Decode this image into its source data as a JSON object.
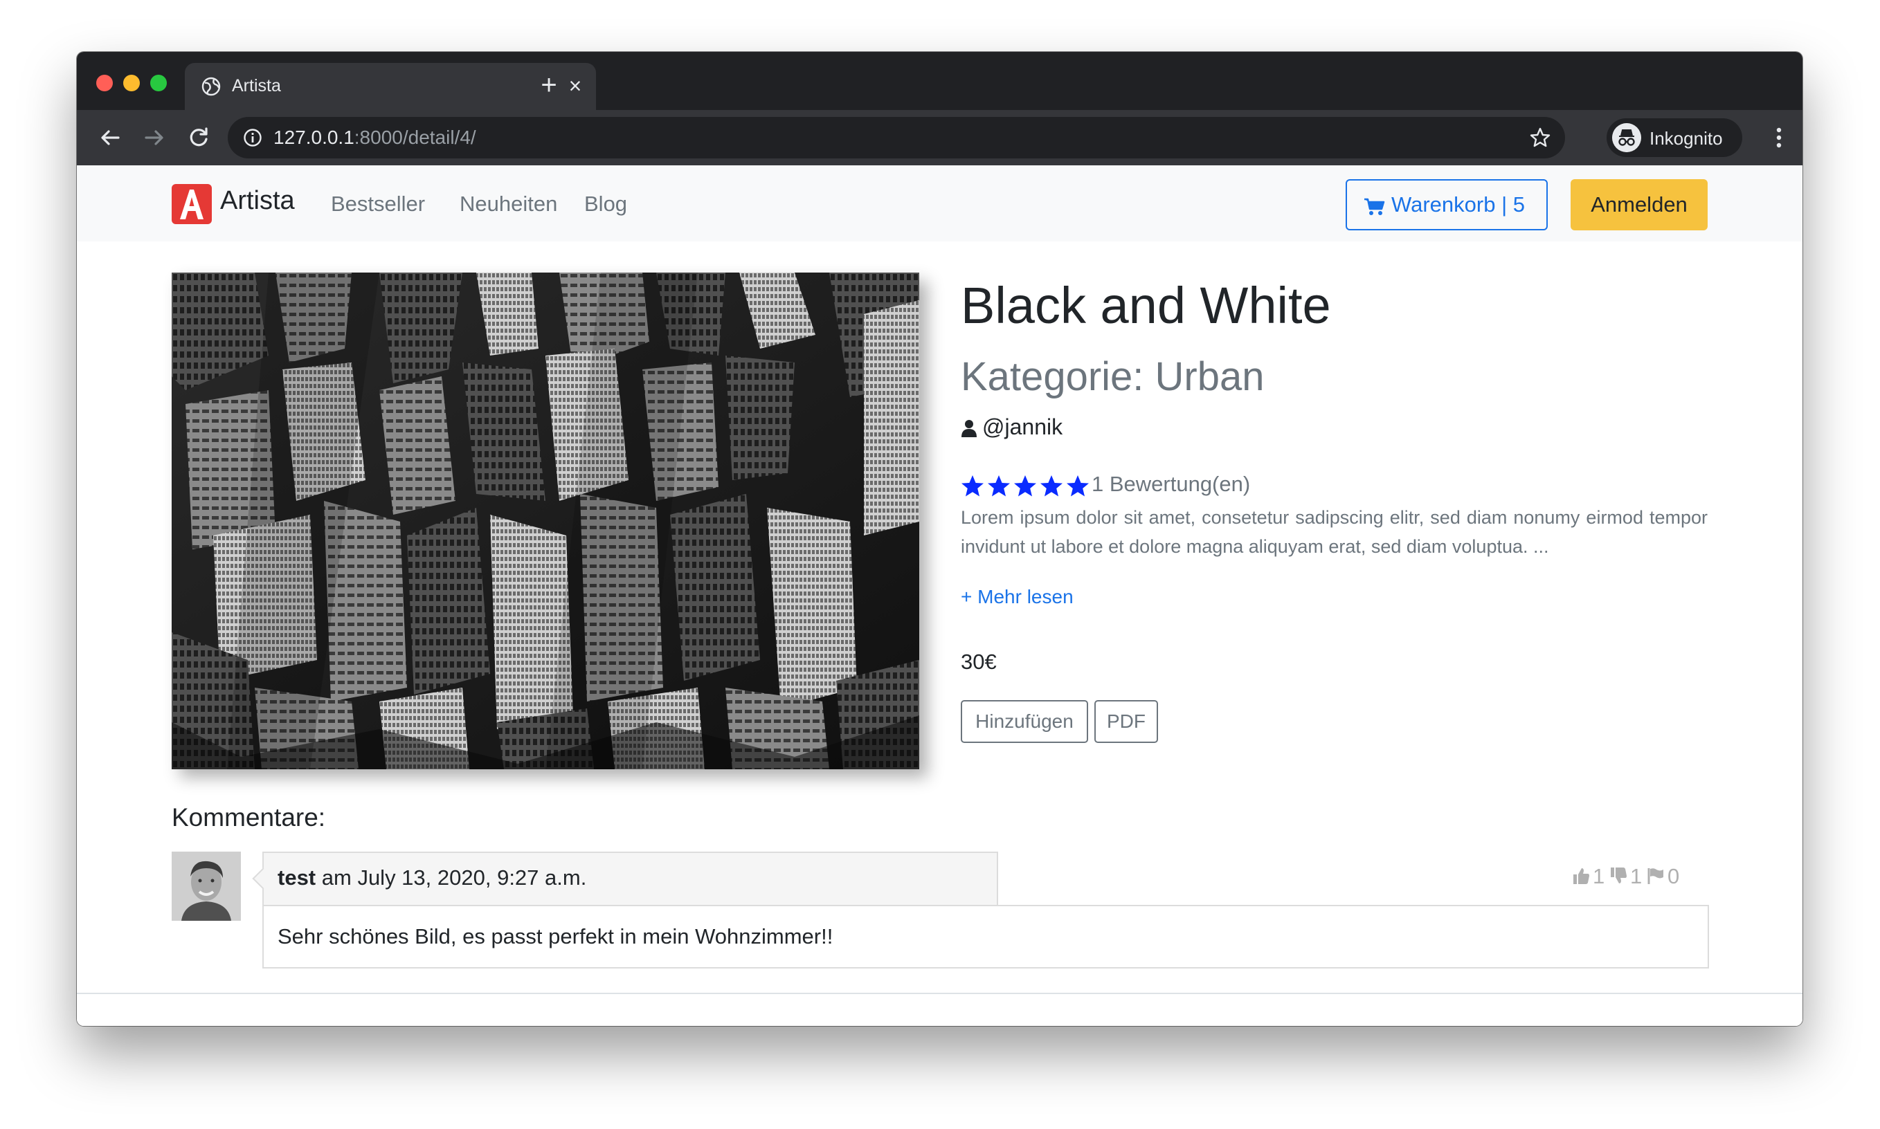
{
  "browser": {
    "tab_title": "Artista",
    "url_host": "127.0.0.1",
    "url_path": ":8000/detail/4/",
    "profile_label": "Inkognito"
  },
  "navbar": {
    "brand": "Artista",
    "links": [
      "Bestseller",
      "Neuheiten",
      "Blog"
    ],
    "cart_label": "Warenkorb | 5",
    "login_label": "Anmelden"
  },
  "product": {
    "title": "Black and White",
    "category": "Kategorie: Urban",
    "author": "@jannik",
    "rating_stars": 5,
    "rating_text": "1 Bewertung(en)",
    "description": "Lorem ipsum dolor sit amet, consetetur sadipscing elitr, sed diam nonumy eirmod tempor invidunt ut labore et dolore magna aliquyam erat, sed diam voluptua. ...",
    "more_link": "+ Mehr lesen",
    "price": "30€",
    "add_button": "Hinzufügen",
    "pdf_button": "PDF"
  },
  "comments": {
    "heading": "Kommentare:",
    "items": [
      {
        "user": "test",
        "date": "am July 13, 2020, 9:27 a.m.",
        "text": "Sehr schönes Bild, es passt perfekt in mein Wohnzimmer!!",
        "likes": "1",
        "dislikes": "1",
        "flags": "0"
      }
    ]
  },
  "colors": {
    "accent": "#1a73e8",
    "login_button": "#f6c23e",
    "logo": "#e53935",
    "stars": "#0a2bff"
  },
  "icons": [
    "globe-icon",
    "close-icon",
    "plus-icon",
    "back-arrow-icon",
    "forward-arrow-icon",
    "reload-icon",
    "info-icon",
    "star-icon",
    "incognito-icon",
    "kebab-menu-icon",
    "cart-icon",
    "user-icon",
    "thumbs-up-icon",
    "thumbs-down-icon",
    "flag-icon"
  ]
}
